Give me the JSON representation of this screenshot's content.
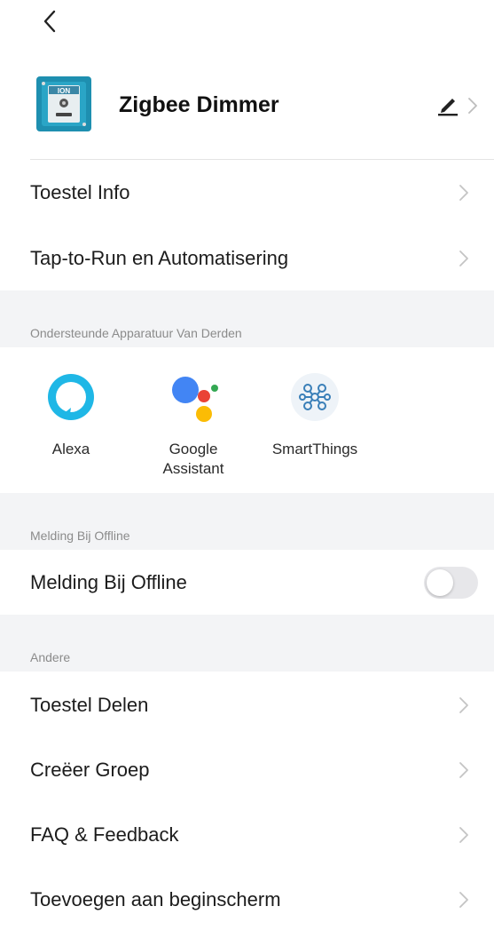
{
  "device": {
    "name": "Zigbee Dimmer",
    "thumb_text": "ION"
  },
  "menu": {
    "device_info": "Toestel Info",
    "tap_to_run": "Tap-to-Run en Automatisering"
  },
  "third_party": {
    "section_title": "Ondersteunde Apparatuur Van Derden",
    "items": [
      {
        "label": "Alexa",
        "icon": "alexa-icon"
      },
      {
        "label": "Google\nAssistant",
        "icon": "google-assistant-icon"
      },
      {
        "label": "SmartThings",
        "icon": "smartthings-icon"
      }
    ]
  },
  "offline": {
    "section_title": "Melding Bij Offline",
    "label": "Melding Bij Offline",
    "enabled": false
  },
  "other": {
    "section_title": "Andere",
    "share": "Toestel Delen",
    "create_group": "Creëer Groep",
    "faq": "FAQ & Feedback",
    "add_home": "Toevoegen aan beginscherm"
  },
  "colors": {
    "section_bg": "#f3f4f6",
    "alexa": "#1fb7e6",
    "google_blue": "#4285f4",
    "google_red": "#ea4335",
    "google_yellow": "#fbbc05",
    "google_green": "#34a853",
    "smartthings": "#3a7fb8",
    "toggle_off": "#e7e7ea"
  }
}
